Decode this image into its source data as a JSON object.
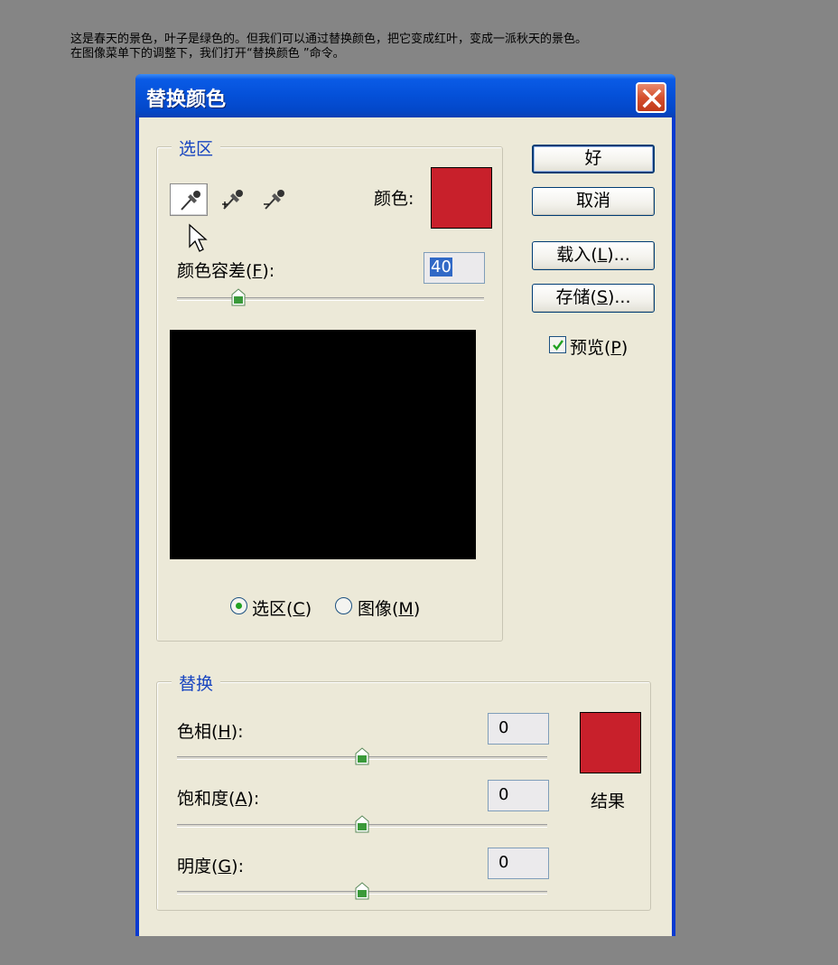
{
  "caption": {
    "line1": "这是春天的景色，叶子是绿色的。但我们可以通过替换颜色，把它变成红叶，变成一派秋天的景色。",
    "line2": "在图像菜单下的调整下，我们打开“替换颜色 ”命令。"
  },
  "window": {
    "title": "替换颜色"
  },
  "selection": {
    "group_label": "选区",
    "color_label": "颜色:",
    "color_swatch": "#c8202b",
    "tolerance_label_pre": "颜色容差(",
    "tolerance_label_key": "F",
    "tolerance_label_post": "):",
    "tolerance_value": "40",
    "tolerance_slider_fraction": 0.2,
    "radio_selection_pre": "选区(",
    "radio_selection_key": "C",
    "radio_selection_post": ")",
    "radio_image_pre": "图像(",
    "radio_image_key": "M",
    "radio_image_post": ")",
    "selected_radio": "selection"
  },
  "buttons": {
    "ok": "好",
    "cancel": "取消",
    "load_pre": "载入(",
    "load_key": "L",
    "load_post": ")...",
    "save_pre": "存储(",
    "save_key": "S",
    "save_post": ")..."
  },
  "preview": {
    "label_pre": "预览(",
    "label_key": "P",
    "label_post": ")",
    "checked": true
  },
  "replace": {
    "group_label": "替换",
    "hue_pre": "色相(",
    "hue_key": "H",
    "hue_post": "):",
    "hue_value": "0",
    "saturation_pre": "饱和度(",
    "saturation_key": "A",
    "saturation_post": "):",
    "saturation_value": "0",
    "lightness_pre": "明度(",
    "lightness_key": "G",
    "lightness_post": "):",
    "lightness_value": "0",
    "result_label": "结果",
    "result_swatch": "#c8202b"
  },
  "icons": [
    "eyedropper-icon",
    "eyedropper-plus-icon",
    "eyedropper-minus-icon",
    "close-icon",
    "cursor-icon",
    "checkmark-icon"
  ]
}
